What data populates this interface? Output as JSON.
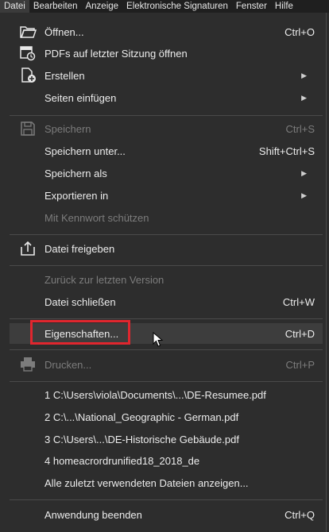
{
  "menubar": [
    "Datei",
    "Bearbeiten",
    "Anzeige",
    "Elektronische Signaturen",
    "Fenster",
    "Hilfe"
  ],
  "items": {
    "open": {
      "label": "Öffnen...",
      "shortcut": "Ctrl+O",
      "icon": "folder-open-icon"
    },
    "pdfs_session": {
      "label": "PDFs auf letzter Sitzung öffnen",
      "icon": "restore-session-icon"
    },
    "create": {
      "label": "Erstellen",
      "icon": "create-pdf-icon"
    },
    "insert_pages": {
      "label": "Seiten einfügen"
    },
    "save": {
      "label": "Speichern",
      "shortcut": "Ctrl+S",
      "icon": "save-icon"
    },
    "save_under": {
      "label": "Speichern unter...",
      "shortcut": "Shift+Ctrl+S"
    },
    "save_as": {
      "label": "Speichern als"
    },
    "export": {
      "label": "Exportieren in"
    },
    "protect": {
      "label": "Mit Kennwort schützen"
    },
    "share": {
      "label": "Datei freigeben",
      "icon": "share-icon"
    },
    "revert": {
      "label": "Zurück zur letzten Version"
    },
    "close": {
      "label": "Datei schließen",
      "shortcut": "Ctrl+W"
    },
    "properties": {
      "label": "Eigenschaften...",
      "shortcut": "Ctrl+D"
    },
    "print": {
      "label": "Drucken...",
      "shortcut": "Ctrl+P",
      "icon": "printer-icon"
    },
    "recent1": {
      "label": "1 C:\\Users\\viola\\Documents\\...\\DE-Resumee.pdf"
    },
    "recent2": {
      "label": "2 C:\\...\\National_Geographic - German.pdf"
    },
    "recent3": {
      "label": "3 C:\\Users\\...\\DE-Historische Gebäude.pdf"
    },
    "recent4": {
      "label": "4 homeacrordrunified18_2018_de"
    },
    "all_recent": {
      "label": "Alle zuletzt verwendeten Dateien anzeigen..."
    },
    "exit": {
      "label": "Anwendung beenden",
      "shortcut": "Ctrl+Q"
    }
  },
  "colors": {
    "highlight_box": "#e0262e",
    "background": "#2d2d2d"
  }
}
